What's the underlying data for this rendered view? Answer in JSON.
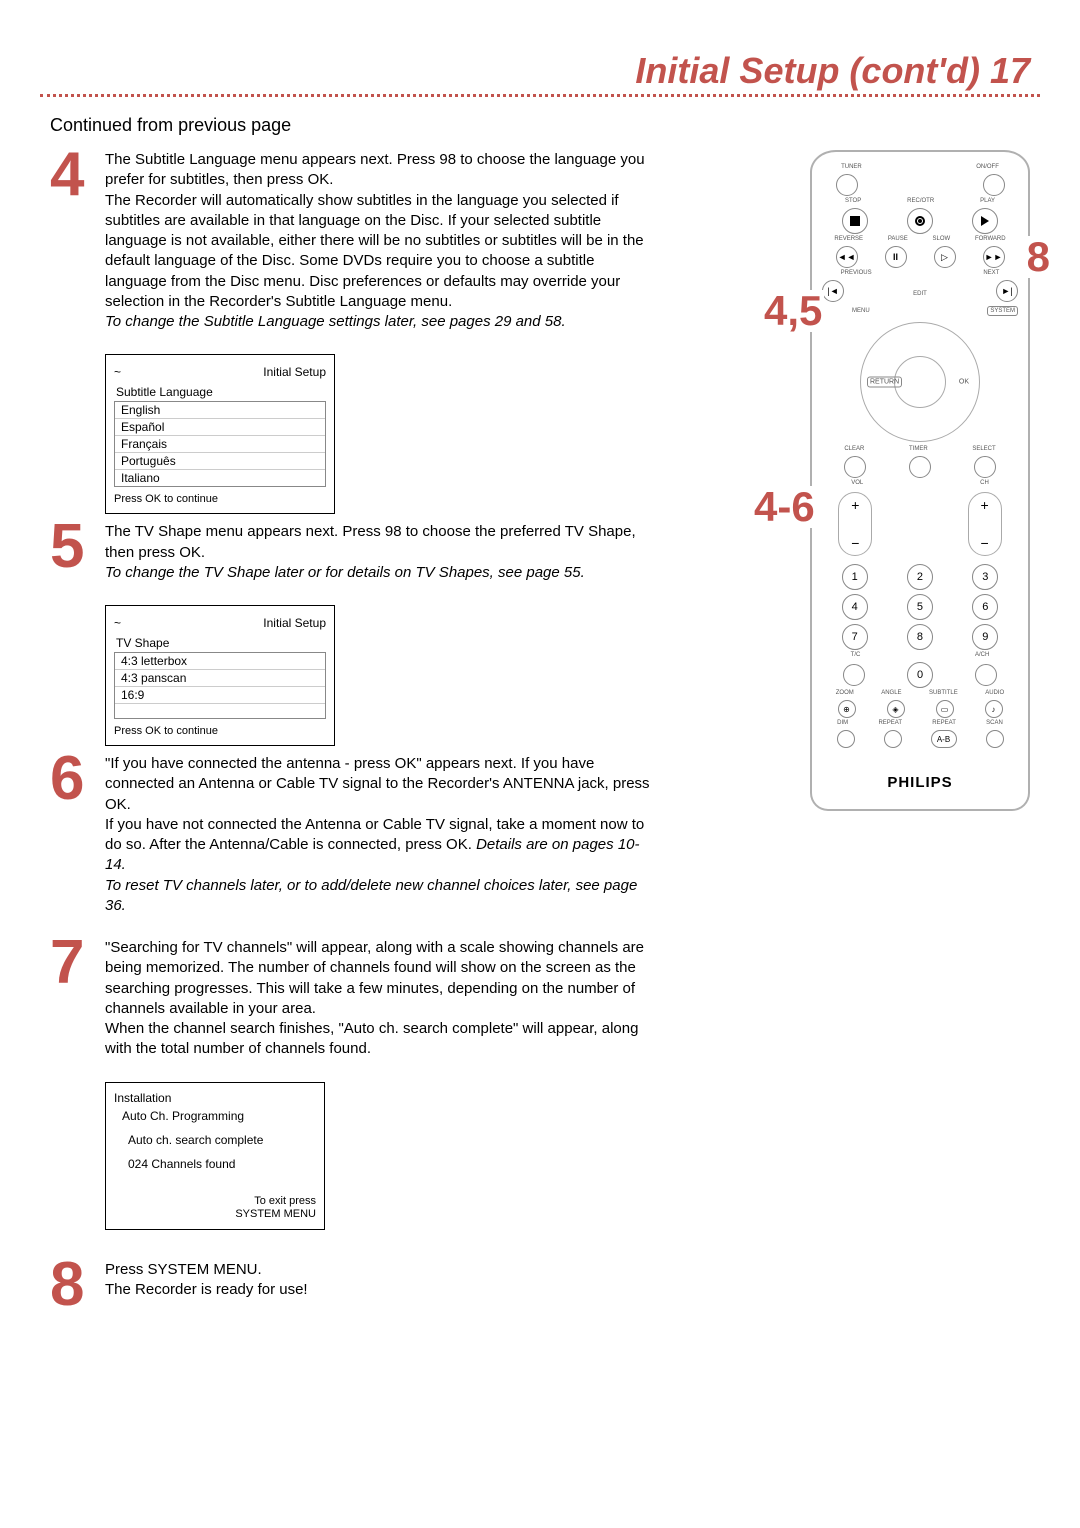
{
  "page": {
    "title": "Initial Setup (cont'd)  17",
    "continued": "Continued from previous page"
  },
  "steps": {
    "s4": {
      "num": "4",
      "p1a": "The Subtitle Language menu appears next. ",
      "p1b": "Press 98",
      "p1c": " to choose the language you prefer for subtitles, then press OK.",
      "p2": "The Recorder will automatically show subtitles in the language you selected if subtitles are available in that language on the Disc. If your selected subtitle language is not available, either there will be no subtitles or subtitles will be in the default language of the Disc. Some DVDs require you to choose a subtitle language from the Disc menu. Disc preferences or defaults may override your selection in the Recorder's Subtitle Language menu.",
      "hint": "To change the Subtitle Language settings later, see pages 29 and 58."
    },
    "s5": {
      "num": "5",
      "p1a": "The TV Shape menu appears next. ",
      "p1b": "Press 98",
      "p1c": " to choose the preferred TV Shape, then press OK.",
      "hint": "To change the TV Shape later or for details on TV Shapes, see page 55."
    },
    "s6": {
      "num": "6",
      "p1": "\"If you have connected the antenna - press OK\" appears next. If you have connected an Antenna or Cable TV signal to the Recorder's ANTENNA jack, press OK.",
      "p2a": "If you have not connected the Antenna or Cable TV signal, take a moment now to do so. After the Antenna/Cable is connected, press OK. ",
      "p2b": "Details are on pages 10-14.",
      "hint": "To reset TV channels later, or to add/delete new channel choices later, see page 36."
    },
    "s7": {
      "num": "7",
      "p1": "\"Searching for TV channels\" will appear, along with a scale showing channels are being memorized. The number of channels found will show on the screen as the searching progresses. This will take a few minutes, depending on the number of channels available in your area.",
      "p2": "When the channel search finishes, \"Auto ch. search complete\" will appear, along with the total number of channels found."
    },
    "s8": {
      "num": "8",
      "p1": "Press SYSTEM MENU.",
      "p2": "The Recorder is ready for use!"
    }
  },
  "osd1": {
    "tilde": "~",
    "title": "Initial Setup",
    "heading": "Subtitle Language",
    "items": [
      "English",
      "Español",
      "Français",
      "Português",
      "Italiano"
    ],
    "footer": "Press OK to continue"
  },
  "osd2": {
    "tilde": "~",
    "title": "Initial Setup",
    "heading": "TV Shape",
    "items": [
      "4:3 letterbox",
      "4:3 panscan",
      "16:9"
    ],
    "footer": "Press OK to continue"
  },
  "osd3": {
    "hdr": "Installation",
    "sub": "Auto Ch. Programming",
    "line1": "Auto ch. search complete",
    "line2": "024 Channels found",
    "exit1": "To exit press",
    "exit2": "SYSTEM MENU"
  },
  "remote": {
    "labels": {
      "tuner": "TUNER",
      "onoff": "ON/OFF",
      "stop": "STOP",
      "recotr": "REC/OTR",
      "play": "PLAY",
      "reverse": "REVERSE",
      "pause": "PAUSE",
      "slow": "SLOW",
      "forward": "FORWARD",
      "previous": "PREVIOUS",
      "next": "NEXT",
      "edit": "EDIT",
      "menu": "MENU",
      "system": "SYSTEM",
      "return": "RETURN",
      "ok": "OK",
      "clear": "CLEAR",
      "timer": "TIMER",
      "select": "SELECT",
      "vol": "VOL",
      "ch": "CH",
      "tc": "T/C",
      "ach": "A/CH",
      "zoom": "ZOOM",
      "angle": "ANGLE",
      "subtitle": "SUBTITLE",
      "audio": "AUDIO",
      "dim": "DIM",
      "repeat": "REPEAT",
      "repeat2": "REPEAT",
      "scan": "SCAN",
      "ab": "A-B"
    },
    "nums": [
      "1",
      "2",
      "3",
      "4",
      "5",
      "6",
      "7",
      "8",
      "9",
      "0"
    ],
    "brand": "PHILIPS",
    "callouts": {
      "c8": "8",
      "c45": "4,5",
      "c46": "4-6"
    }
  }
}
